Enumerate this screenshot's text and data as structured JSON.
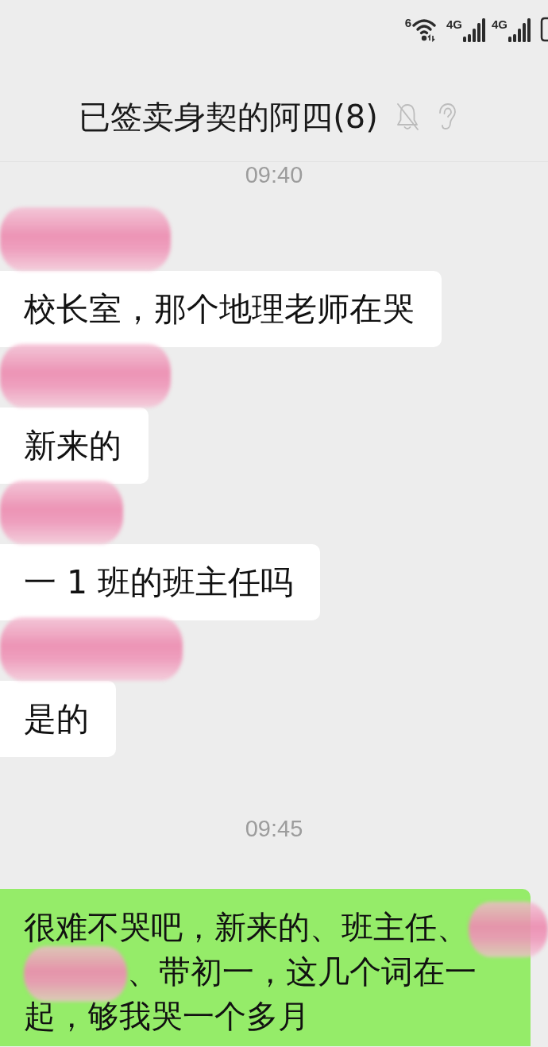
{
  "status_bar": {
    "wifi_label": "6",
    "networks": [
      {
        "label": "4G"
      },
      {
        "label": "4G"
      }
    ]
  },
  "chat": {
    "title": "已签卖身契的阿四(8)",
    "muted": true,
    "earpiece_mode": true
  },
  "messages": [
    {
      "kind": "time",
      "text": "09:40"
    },
    {
      "kind": "incoming",
      "sender_redacted": true,
      "text": "校长室，那个地理老师在哭"
    },
    {
      "kind": "incoming",
      "sender_redacted": true,
      "text": "新来的"
    },
    {
      "kind": "incoming",
      "sender_redacted": true,
      "text": "一 1 班的班主任吗"
    },
    {
      "kind": "incoming",
      "sender_redacted": true,
      "text": "是的"
    },
    {
      "kind": "time",
      "text": "09:45"
    },
    {
      "kind": "outgoing",
      "lines": [
        [
          {
            "kind": "text",
            "text": "很难不哭吧，新来的、班主任、"
          },
          {
            "kind": "redaction"
          }
        ],
        [
          {
            "kind": "redaction"
          },
          {
            "kind": "text",
            "text": "、带初一，这几个词在一"
          }
        ],
        [
          {
            "kind": "text",
            "text": "起，够我哭一个多月"
          }
        ]
      ]
    }
  ]
}
